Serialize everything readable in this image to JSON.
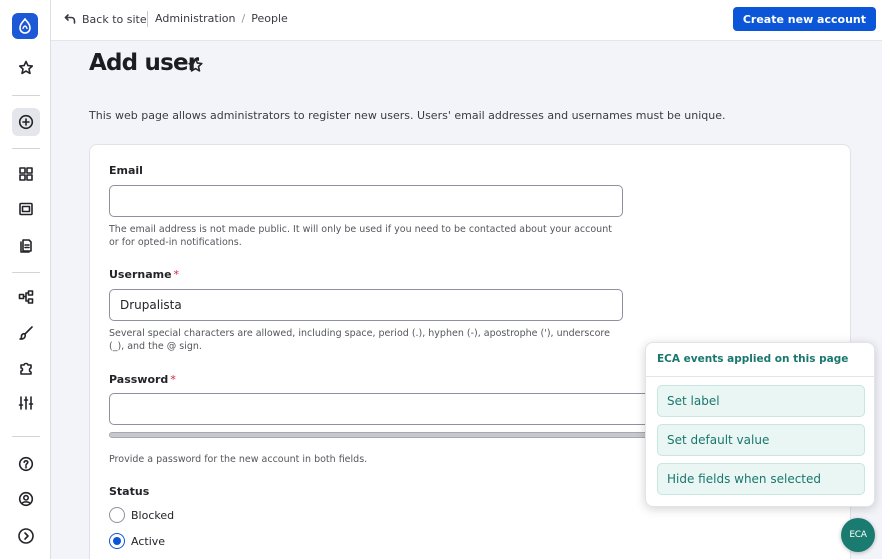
{
  "topbar": {
    "back_label": "Back to site",
    "breadcrumb": [
      "Administration",
      "People"
    ],
    "breadcrumb_separator": "/",
    "create_button": "Create new account"
  },
  "sidebar": {
    "logo": "drupal-logo",
    "items": [
      "star-icon",
      "plus-circle-icon",
      "grid-icon",
      "content-icon",
      "files-icon",
      "structure-icon",
      "appearance-icon",
      "extend-icon",
      "config-icon",
      "help-icon",
      "user-icon",
      "expand-icon"
    ]
  },
  "page": {
    "title": "Add user",
    "intro": "This web page allows administrators to register new users. Users' email addresses and usernames must be unique."
  },
  "form": {
    "email_label": "Email",
    "email_value": "",
    "email_desc_1": "The email address is not made public. It will only be used if you need to be contacted about your account",
    "email_desc_2": "or for opted-in notifications.",
    "username_label": "Username",
    "username_value": "Drupalista",
    "username_desc_1": "Several special characters are allowed, including space, period (.), hyphen (-), apostrophe ('), underscore",
    "username_desc_2": "(_), and the @ sign.",
    "required_mark": "*",
    "password_label": "Password",
    "password_desc": "Provide a password for the new account in both fields.",
    "status_label": "Status",
    "status_options": [
      "Blocked",
      "Active"
    ],
    "status_selected": "Active"
  },
  "eca": {
    "title": "ECA events applied on this page",
    "items": [
      "Set label",
      "Set default value",
      "Hide fields when selected"
    ],
    "fab_label": "ECA"
  },
  "colors": {
    "primary": "#0b55d9",
    "eca_accent": "#19776e",
    "required": "#d3233a"
  }
}
